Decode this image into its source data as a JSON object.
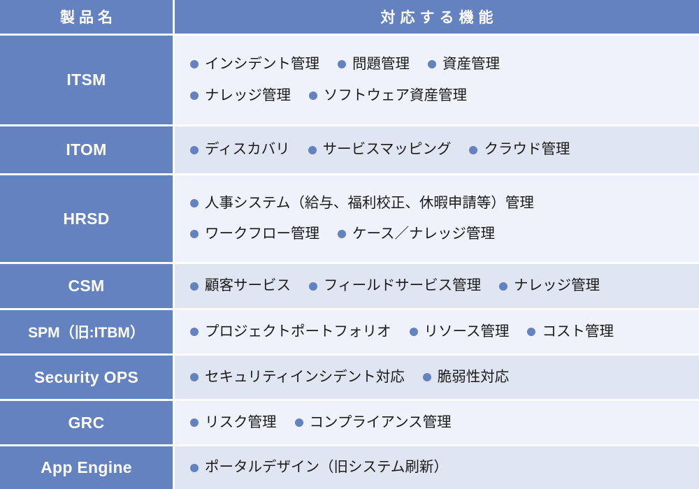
{
  "table": {
    "header": {
      "product_label": "製品名",
      "features_label": "対応する機能"
    },
    "colors": {
      "header_blue": "#6481C0",
      "product_cell_blue": "#6481C0",
      "row_light": "#EFF2FA",
      "row_alt": "#DFE5F1",
      "bullet": "#6481C0",
      "text": "#1A1A1A",
      "grid_line": "#FFFFFF"
    },
    "rows": [
      {
        "product": "ITSM",
        "lines": [
          [
            "インシデント管理",
            "問題管理",
            "資産管理"
          ],
          [
            "ナレッジ管理",
            "ソフトウェア資産管理"
          ]
        ]
      },
      {
        "product": "ITOM",
        "lines": [
          [
            "ディスカバリ",
            "サービスマッピング",
            "クラウド管理"
          ]
        ]
      },
      {
        "product": "HRSD",
        "lines": [
          [
            "人事システム（給与、福利校正、休暇申請等）管理"
          ],
          [
            "ワークフロー管理",
            "ケース／ナレッジ管理"
          ]
        ]
      },
      {
        "product": "CSM",
        "lines": [
          [
            "顧客サービス",
            "フィールドサービス管理",
            "ナレッジ管理"
          ]
        ]
      },
      {
        "product": "SPM（旧:ITBM）",
        "lines": [
          [
            "プロジェクトポートフォリオ",
            "リソース管理",
            "コスト管理"
          ]
        ]
      },
      {
        "product": "Security OPS",
        "lines": [
          [
            "セキュリティインシデント対応",
            "脆弱性対応"
          ]
        ]
      },
      {
        "product": "GRC",
        "lines": [
          [
            "リスク管理",
            "コンプライアンス管理"
          ]
        ]
      },
      {
        "product": "App Engine",
        "lines": [
          [
            "ポータルデザイン（旧システム刷新）"
          ]
        ]
      }
    ]
  }
}
